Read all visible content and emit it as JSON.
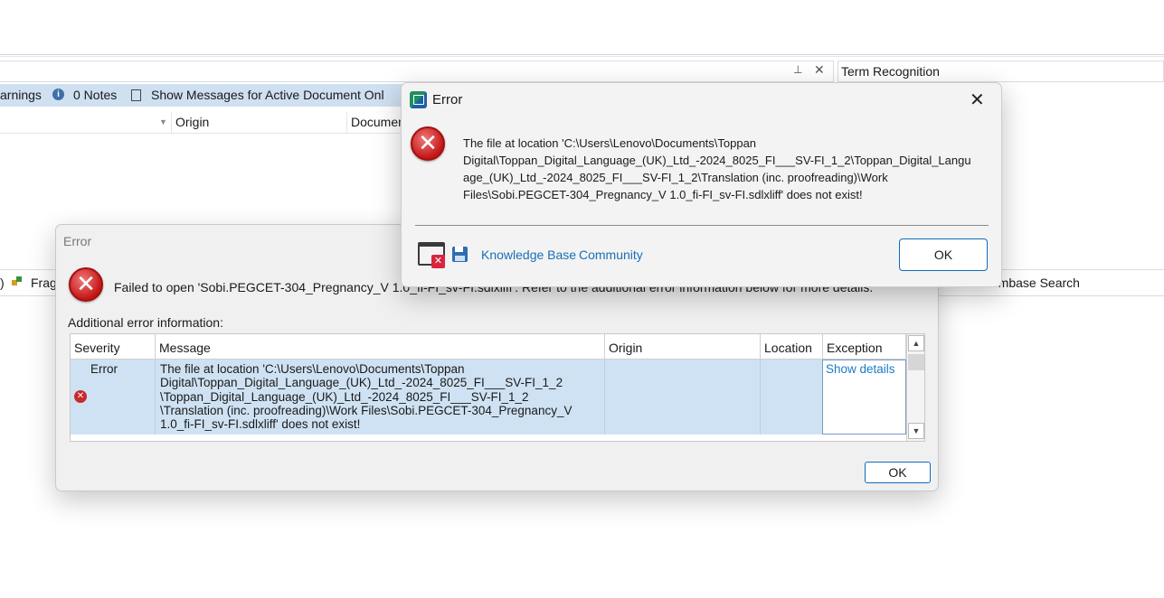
{
  "background": {
    "term_recognition": "Term Recognition",
    "messages_toolbar": {
      "warnings": "arnings",
      "notes": "0 Notes",
      "show_messages": "Show Messages for Active Document Onl"
    },
    "columns": {
      "origin": "Origin",
      "document": "Documen"
    },
    "bottom_bar": {
      "fragment": "Frag",
      "termbase_search": "rmbase Search"
    }
  },
  "dialog_main": {
    "title": "Error",
    "failed_message": "Failed to open 'Sobi.PEGCET-304_Pregnancy_V 1.0_fi-FI_sv-FI.sdlxliff'. Refer to the additional error information below for more details.",
    "additional_label": "Additional error information:",
    "columns": {
      "severity": "Severity",
      "message": "Message",
      "origin": "Origin",
      "location": "Location",
      "exception": "Exception"
    },
    "row": {
      "severity": "Error",
      "message_lines": [
        "The file at location 'C:\\Users\\Lenovo\\Documents\\Toppan",
        "Digital\\Toppan_Digital_Language_(UK)_Ltd_-2024_8025_FI___SV-FI_1_2",
        "\\Toppan_Digital_Language_(UK)_Ltd_-2024_8025_FI___SV-FI_1_2",
        "\\Translation (inc. proofreading)\\Work Files\\Sobi.PEGCET-304_Pregnancy_V",
        "1.0_fi-FI_sv-FI.sdlxliff' does not exist!"
      ],
      "exception_link": "Show details"
    },
    "ok_label": "OK"
  },
  "dialog_top": {
    "title": "Error",
    "message_lines": [
      "The file at location 'C:\\Users\\Lenovo\\Documents\\Toppan",
      "Digital\\Toppan_Digital_Language_(UK)_Ltd_-2024_8025_FI___SV-FI_1_2\\Toppan_Digital_Langu",
      "age_(UK)_Ltd_-2024_8025_FI___SV-FI_1_2\\Translation (inc. proofreading)\\Work",
      "Files\\Sobi.PEGCET-304_Pregnancy_V 1.0_fi-FI_sv-FI.sdlxliff' does not exist!"
    ],
    "knowledge_base": "Knowledge Base",
    "community": "Community",
    "ok_label": "OK"
  }
}
